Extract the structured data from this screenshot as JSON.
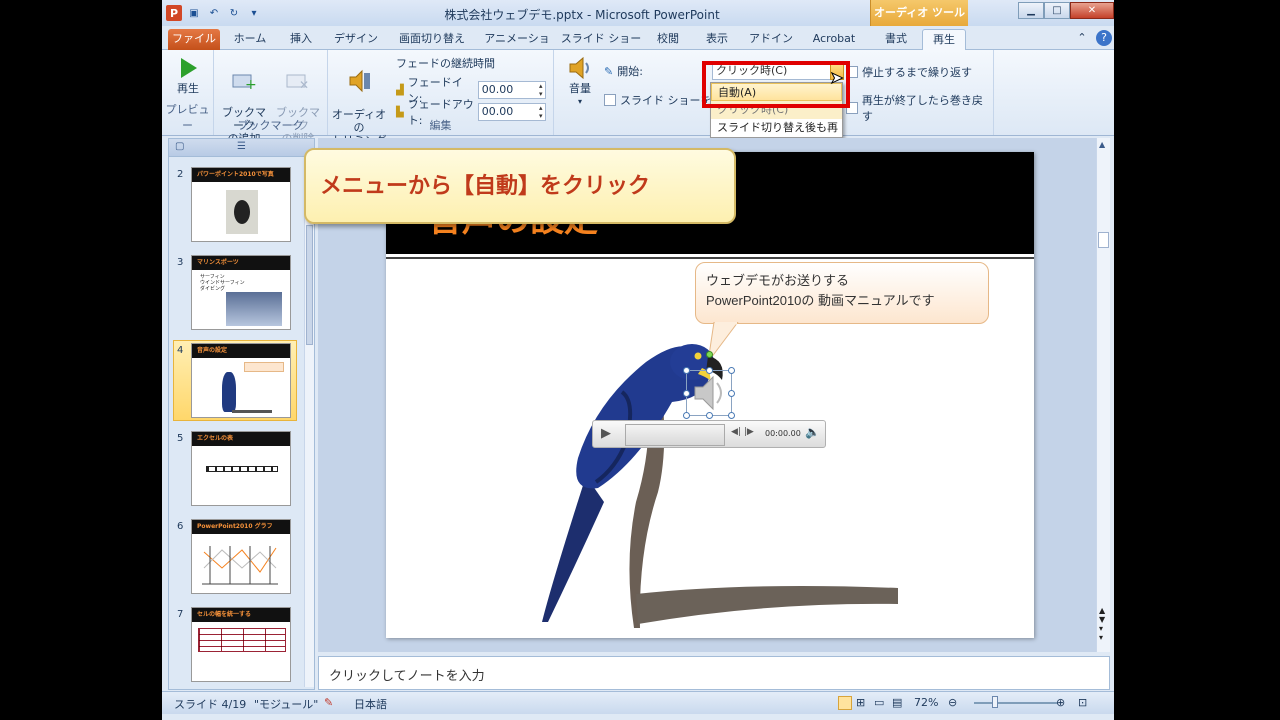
{
  "window": {
    "title": "株式会社ウェブデモ.pptx - Microsoft PowerPoint",
    "context_tools": "オーディオ ツール"
  },
  "tabs": [
    "ファイル",
    "ホーム",
    "挿入",
    "デザイン",
    "画面切り替え",
    "アニメーション",
    "スライド ショー",
    "校閲",
    "表示",
    "アドイン",
    "Acrobat",
    "書式",
    "再生"
  ],
  "ribbon": {
    "preview": {
      "play": "再生",
      "group": "プレビュー"
    },
    "bookmark": {
      "add": "ブックマーク\nの追加",
      "remove": "ブックマーク\nの削除",
      "group": "ブックマーク"
    },
    "edit": {
      "trim": "オーディオの\nトリミング",
      "fade_title": "フェードの継続時間",
      "fade_in_label": "フェードイン:",
      "fade_in_value": "00.00",
      "fade_out_label": "フェードアウト:",
      "fade_out_value": "00.00",
      "group": "編集"
    },
    "options": {
      "volume": "音量",
      "start_label": "開始:",
      "start_value": "クリック時(C)",
      "slideshow_partial": "スライド ショーを実",
      "loop": "停止するまで繰り返す",
      "rewind": "再生が終了したら巻き戻す"
    }
  },
  "dropdown": {
    "items": [
      "自動(A)",
      "クリック時(C)",
      "スライド切り替え後も再生"
    ]
  },
  "thumbnails": [
    {
      "num": "2",
      "title": "パワーポイント2010で写真"
    },
    {
      "num": "3",
      "title": "マリンスポーツ",
      "bullets": [
        "サーフィン",
        "ウインドサーフィン",
        "ダイビング"
      ]
    },
    {
      "num": "4",
      "title": "音声の設定"
    },
    {
      "num": "5",
      "title": "エクセルの表"
    },
    {
      "num": "6",
      "title": "PowerPoint2010 グラフ"
    },
    {
      "num": "7",
      "title": "セルの幅を統一する"
    }
  ],
  "slide": {
    "title": "音声の設定",
    "speech_line1": "ウェブデモがお送りする",
    "speech_line2": "PowerPoint2010の 動画マニュアルです",
    "player_time": "00:00.00"
  },
  "instruction": "メニューから【自動】をクリック",
  "notes_placeholder": "クリックしてノートを入力",
  "status": {
    "slide": "スライド 4/19",
    "theme": "\"モジュール\"",
    "language": "日本語",
    "zoom": "72%"
  }
}
